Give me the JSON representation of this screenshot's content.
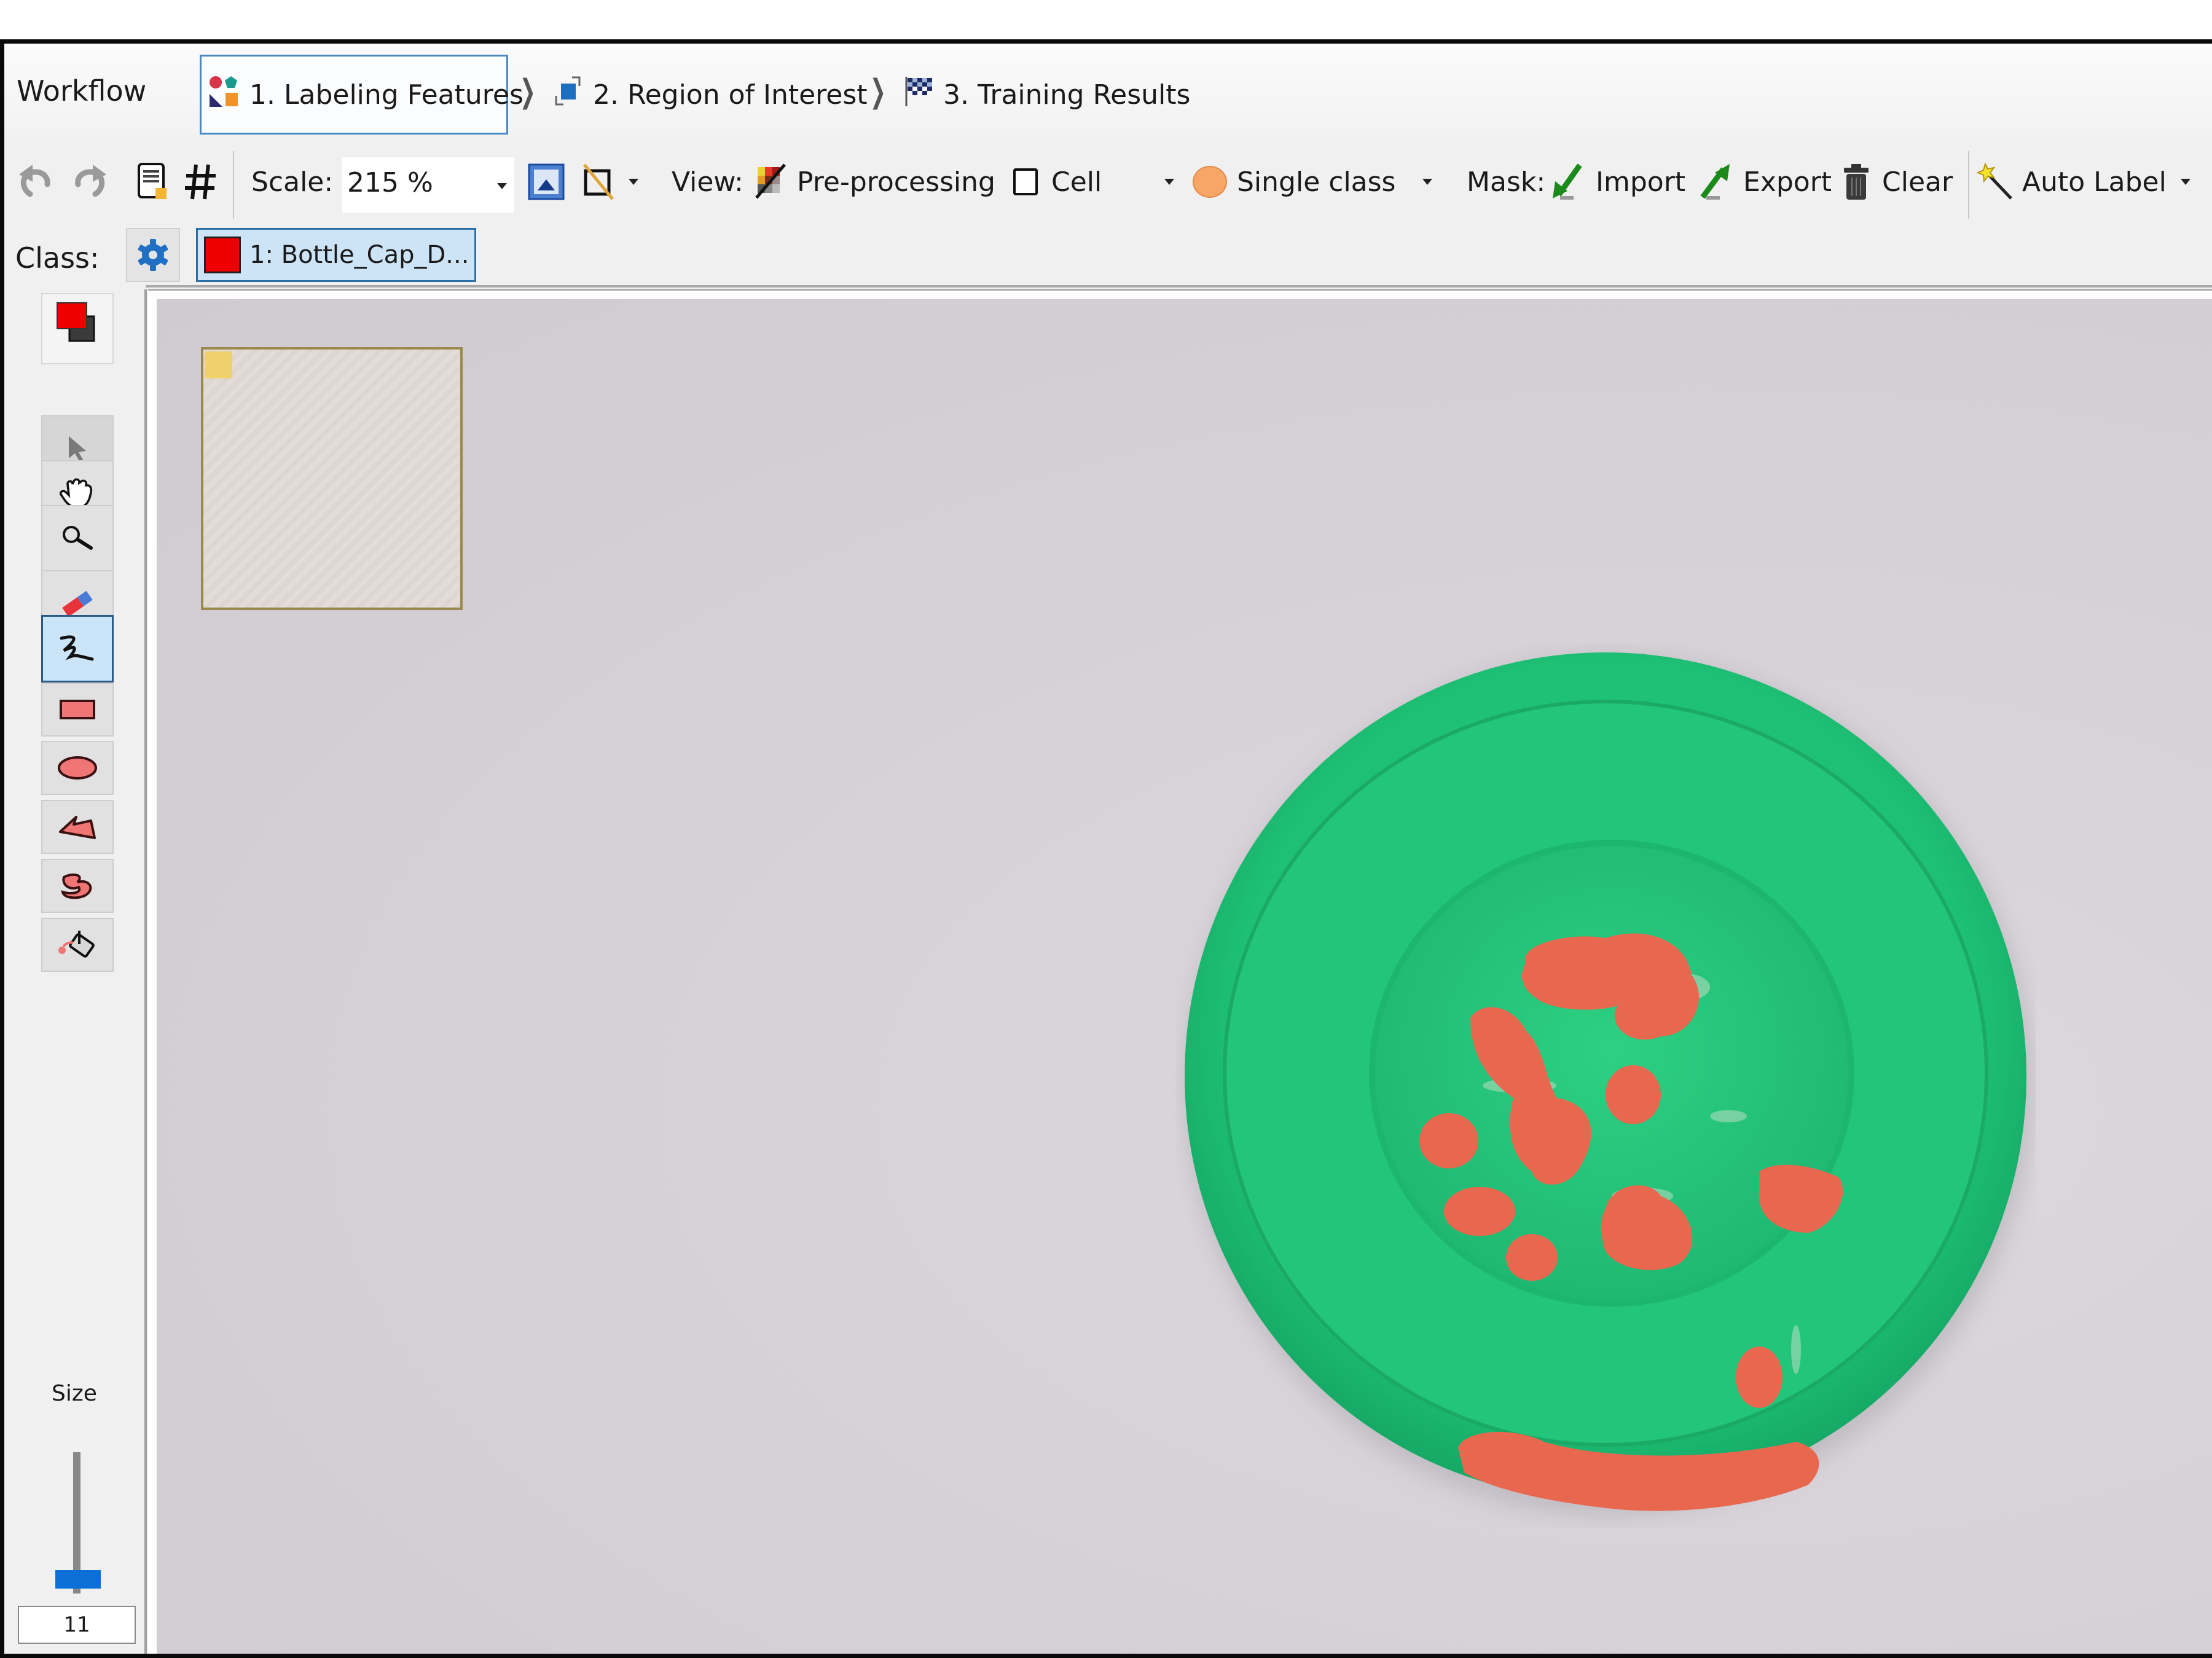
{
  "workflow": {
    "title": "Workflow",
    "steps": [
      {
        "label": "1. Labeling Features",
        "icon": "labeling-features-icon",
        "active": true
      },
      {
        "label": "2. Region of Interest",
        "icon": "region-of-interest-icon",
        "active": false
      },
      {
        "label": "3. Training Results",
        "icon": "checkered-flag-icon",
        "active": false
      }
    ],
    "separator": "❯"
  },
  "toolbar": {
    "undo_icon": "undo-icon",
    "redo_icon": "redo-icon",
    "scale_label": "Scale:",
    "scale_value": "215 %",
    "view_label": "View:",
    "preprocessing_label": "Pre-processing",
    "cell_label": "Cell",
    "cell_checked": false,
    "single_class_label": "Single class",
    "mask_label": "Mask:",
    "import_label": "Import",
    "export_label": "Export",
    "clear_label": "Clear",
    "auto_label": "Auto Label"
  },
  "class_bar": {
    "label": "Class:",
    "selected_class": "1: Bottle_Cap_D...",
    "selected_class_color": "#ee0000"
  },
  "tools": {
    "items": [
      {
        "name": "select",
        "active": false
      },
      {
        "name": "pan",
        "active": false
      },
      {
        "name": "zoom",
        "active": false
      },
      {
        "name": "eraser",
        "active": false
      },
      {
        "name": "freehand",
        "active": true
      },
      {
        "name": "rectangle",
        "active": false
      },
      {
        "name": "ellipse",
        "active": false
      },
      {
        "name": "polygon",
        "active": false
      },
      {
        "name": "freehand-region",
        "active": false
      },
      {
        "name": "fill",
        "active": false
      }
    ],
    "size_label": "Size",
    "size_value": "11"
  },
  "colors": {
    "accent": "#0a6fd6",
    "label_overlay": "#e8684f",
    "cap_green": "#1fc479"
  }
}
